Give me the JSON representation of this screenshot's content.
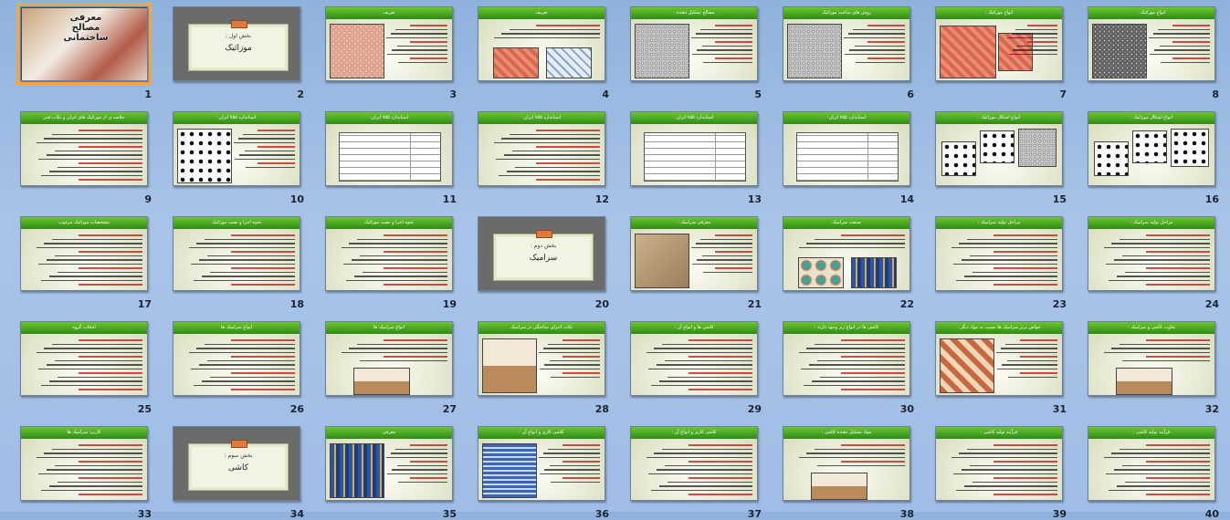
{
  "slides": [
    {
      "number": "1",
      "title": "معرفی مصالح ساختمانی",
      "layout": "title",
      "selected": true
    },
    {
      "number": "2",
      "title": "",
      "layout": "section",
      "section_sub": "بخش اول :",
      "section_main": "موزائیک"
    },
    {
      "number": "3",
      "title": "تعریف",
      "layout": "pic-text",
      "pics": [
        "terrazzo"
      ]
    },
    {
      "number": "4",
      "title": "تعریف",
      "layout": "text-pics",
      "pics": [
        "red",
        "blue"
      ]
    },
    {
      "number": "5",
      "title": "مصالح تشکیل دهنده :",
      "layout": "pic-text",
      "pics": [
        "granite"
      ]
    },
    {
      "number": "6",
      "title": "روش های ساخت موزائیک",
      "layout": "pic-text",
      "pics": [
        "granite"
      ]
    },
    {
      "number": "7",
      "title": "انواع موزائیک :",
      "layout": "two-pics",
      "pics": [
        "red",
        "red"
      ]
    },
    {
      "number": "8",
      "title": "انواع موزائیک :",
      "layout": "pic-text",
      "pics": [
        "darkgran"
      ]
    },
    {
      "number": "9",
      "title": "خلاصه ی از موزائیک های ایران و نکات فنی",
      "layout": "text"
    },
    {
      "number": "10",
      "title": "استاندارد ۷۵۵ ایران:",
      "layout": "pic-text",
      "pics": [
        "pattern"
      ]
    },
    {
      "number": "11",
      "title": "استاندارد ۷۵۵ ایران:",
      "layout": "table"
    },
    {
      "number": "12",
      "title": "استاندارد ۷۵۵ ایران:",
      "layout": "text"
    },
    {
      "number": "13",
      "title": "استاندارد ۷۵۵ ایران:",
      "layout": "table"
    },
    {
      "number": "14",
      "title": "استاندارد ۷۵۵ ایران:",
      "layout": "table"
    },
    {
      "number": "15",
      "title": "انواع اشکال موزائیک :",
      "layout": "multi-pics",
      "pics": [
        "pattern",
        "pattern",
        "granite"
      ]
    },
    {
      "number": "16",
      "title": "انواع اشکال موزائیک :",
      "layout": "multi-pics",
      "pics": [
        "pattern",
        "pattern",
        "pattern"
      ]
    },
    {
      "number": "17",
      "title": "مشخصات موزائیک مرغوب",
      "layout": "text"
    },
    {
      "number": "18",
      "title": "نحوه اجرا و نصب موزائیک",
      "layout": "text"
    },
    {
      "number": "19",
      "title": "نحوه اجرا و نصب موزائیک",
      "layout": "text"
    },
    {
      "number": "20",
      "title": "",
      "layout": "section",
      "section_sub": "بخش دوم :",
      "section_main": "سرامیک"
    },
    {
      "number": "21",
      "title": "معرفی سرامیک :",
      "layout": "pic-text",
      "pics": [
        "sand"
      ]
    },
    {
      "number": "22",
      "title": "صنعت سرامیک",
      "layout": "text-pics",
      "pics": [
        "star",
        "mosque"
      ]
    },
    {
      "number": "23",
      "title": "مراحل تولید سرامیک :",
      "layout": "text"
    },
    {
      "number": "24",
      "title": "مراحل تولید سرامیک :",
      "layout": "text"
    },
    {
      "number": "25",
      "title": "انتخاب گروه",
      "layout": "text"
    },
    {
      "number": "26",
      "title": "انواع سرامیک ها",
      "layout": "text"
    },
    {
      "number": "27",
      "title": "انواع سرامیک ها",
      "layout": "text-pic",
      "pics": [
        "room"
      ]
    },
    {
      "number": "28",
      "title": "نکات اجرای ساختگی در سرامیک",
      "layout": "pic-text",
      "pics": [
        "room"
      ]
    },
    {
      "number": "29",
      "title": "کاشی ها و انواع آن :",
      "layout": "text"
    },
    {
      "number": "30",
      "title": "کاشی ها در انواع زیر وجود دارند :",
      "layout": "text"
    },
    {
      "number": "31",
      "title": "خواص برتر سرامیک ها نسبت به مواد دیگر :",
      "layout": "pic-text",
      "pics": [
        "tile"
      ]
    },
    {
      "number": "32",
      "title": "تفاوت کاشی و سرامیک :",
      "layout": "text-pic",
      "pics": [
        "room"
      ]
    },
    {
      "number": "33",
      "title": "کاربرد سرامیک ها",
      "layout": "text"
    },
    {
      "number": "34",
      "title": "",
      "layout": "section",
      "section_sub": "بخش سوم :",
      "section_main": "کاشی"
    },
    {
      "number": "35",
      "title": "معرفی",
      "layout": "pic-text",
      "pics": [
        "mosque"
      ]
    },
    {
      "number": "36",
      "title": "کاشی کاری و انواع آن :",
      "layout": "pic-text",
      "pics": [
        "blueprint"
      ]
    },
    {
      "number": "37",
      "title": "کاشی کاری و انواع آن :",
      "layout": "text"
    },
    {
      "number": "38",
      "title": "مواد تشکیل دهنده کاشی :",
      "layout": "text-pic",
      "pics": [
        "room"
      ]
    },
    {
      "number": "39",
      "title": "فرآیند تولید کاشی :",
      "layout": "text"
    },
    {
      "number": "40",
      "title": "فرآیند تولید کاشی :",
      "layout": "text"
    }
  ]
}
